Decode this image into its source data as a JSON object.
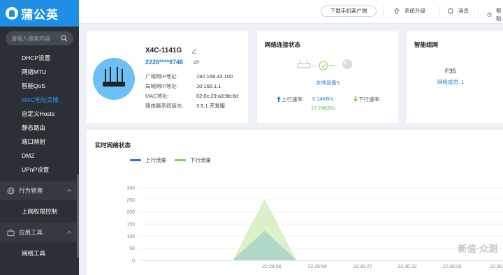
{
  "brand": {
    "name": "蒲公英"
  },
  "sidebar": {
    "search_placeholder": "请输入搜索内容",
    "items": [
      {
        "label": "DHCP设置"
      },
      {
        "label": "网络MTU"
      },
      {
        "label": "智能QoS"
      },
      {
        "label": "MAC地址克隆",
        "active": true
      },
      {
        "label": "自定义Hosts"
      },
      {
        "label": "静态路由"
      },
      {
        "label": "端口映射"
      },
      {
        "label": "DMZ"
      },
      {
        "label": "UPnP设置"
      }
    ],
    "sections": [
      {
        "label": "行为管理",
        "icon": "globe-icon",
        "items": [
          {
            "label": "上网权限控制"
          }
        ]
      },
      {
        "label": "应用工具",
        "icon": "briefcase-icon",
        "items": [
          {
            "label": "网络工具"
          }
        ]
      }
    ]
  },
  "topbar": {
    "download_label": "下载手机客户端",
    "upgrade_label": "系统升级",
    "messages_label": "消息",
    "help_label": "帮助"
  },
  "device": {
    "name": "X4C-1141G",
    "serial": "2226****9748",
    "rows": [
      {
        "k": "广域网IP地址:",
        "v": "192.168.43.100"
      },
      {
        "k": "局域网IP地址:",
        "v": "10.168.1.1"
      },
      {
        "k": "MAC地址:",
        "v": "02:0c:29:a3:9b:6d"
      },
      {
        "k": "路由器系统版本:",
        "v": "3.5.1 开发版"
      }
    ]
  },
  "network": {
    "title": "网络连接状态",
    "local_label": "本地设备3",
    "up_label": "上行速率:",
    "up_value": "5.14KB/s",
    "down_label": "下行速率:",
    "down_value": "17.74KB/s"
  },
  "mesh": {
    "title": "智能组网",
    "name": "F35",
    "members": "网络成员: 1"
  },
  "chart_data": {
    "type": "area",
    "title": "实时网络状态",
    "series": [
      {
        "name": "上行流量",
        "color": "#1f7fd8",
        "fill": "#a9d3c9",
        "values": [
          0,
          0,
          0,
          0,
          120,
          0,
          0,
          0,
          0,
          0,
          0,
          0
        ]
      },
      {
        "name": "下行流量",
        "color": "#7fd14f",
        "fill": "#d3efbf",
        "values": [
          0,
          0,
          0,
          0,
          250,
          0,
          0,
          0,
          0,
          0,
          0,
          0
        ]
      }
    ],
    "x": [
      "22:29:56",
      "22:29:59",
      "22:30:27",
      "22:30:32",
      "22:30:39",
      "22:30:3"
    ],
    "yticks": [
      0,
      50,
      100,
      150,
      200,
      250,
      300
    ],
    "ylim": [
      0,
      300
    ]
  }
}
